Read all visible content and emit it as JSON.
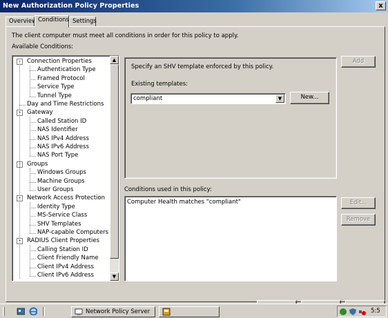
{
  "window": {
    "title": "New Authorization Policy Properties",
    "close_glyph": "x"
  },
  "tabs": [
    {
      "label": "Overview"
    },
    {
      "label": "Conditions"
    },
    {
      "label": "Settings"
    }
  ],
  "active_tab": "Conditions",
  "conditions": {
    "intro_text": "The client computer must meet all conditions in order for this policy to apply.",
    "available_label": "Available Conditions:",
    "tree": [
      {
        "label": "Connection Properties",
        "level": 0,
        "expanded": true
      },
      {
        "label": "Authentication Type",
        "level": 1
      },
      {
        "label": "Framed Protocol",
        "level": 1
      },
      {
        "label": "Service Type",
        "level": 1
      },
      {
        "label": "Tunnel Type",
        "level": 1
      },
      {
        "label": "Day and Time Restrictions",
        "level": 0,
        "leaf": true
      },
      {
        "label": "Gateway",
        "level": 0,
        "expanded": true
      },
      {
        "label": "Called Station ID",
        "level": 1
      },
      {
        "label": "NAS Identifier",
        "level": 1
      },
      {
        "label": "NAS IPv4 Address",
        "level": 1
      },
      {
        "label": "NAS IPv6 Address",
        "level": 1
      },
      {
        "label": "NAS Port Type",
        "level": 1
      },
      {
        "label": "Groups",
        "level": 0,
        "expanded": true
      },
      {
        "label": "Windows Groups",
        "level": 1
      },
      {
        "label": "Machine Groups",
        "level": 1
      },
      {
        "label": "User Groups",
        "level": 1
      },
      {
        "label": "Network Access Protection",
        "level": 0,
        "expanded": true
      },
      {
        "label": "Identity Type",
        "level": 1
      },
      {
        "label": "MS-Service Class",
        "level": 1
      },
      {
        "label": "SHV Templates",
        "level": 1
      },
      {
        "label": "NAP-capable Computers",
        "level": 1
      },
      {
        "label": "RADIUS Client Properties",
        "level": 0,
        "expanded": true
      },
      {
        "label": "Calling Station ID",
        "level": 1
      },
      {
        "label": "Client Friendly Name",
        "level": 1
      },
      {
        "label": "Client IPv4 Address",
        "level": 1
      },
      {
        "label": "Client IPv6 Address",
        "level": 1
      }
    ],
    "detail": {
      "description": "Specify an SHV template enforced by this policy.",
      "existing_label": "Existing templates:",
      "template_value": "compliant",
      "new_button": "New..."
    },
    "add_button": "Add",
    "used_label": "Conditions used in this policy:",
    "used_items": [
      "Computer Health matches \"compliant\""
    ],
    "edit_button": "Edit...",
    "remove_button": "Remove"
  },
  "taskbar": {
    "task_label": "Network Policy Server",
    "clock": "5:5"
  },
  "colors": {
    "titlebar_start": "#0a246a",
    "titlebar_end": "#a6caf0",
    "face": "#d4d0c8"
  }
}
